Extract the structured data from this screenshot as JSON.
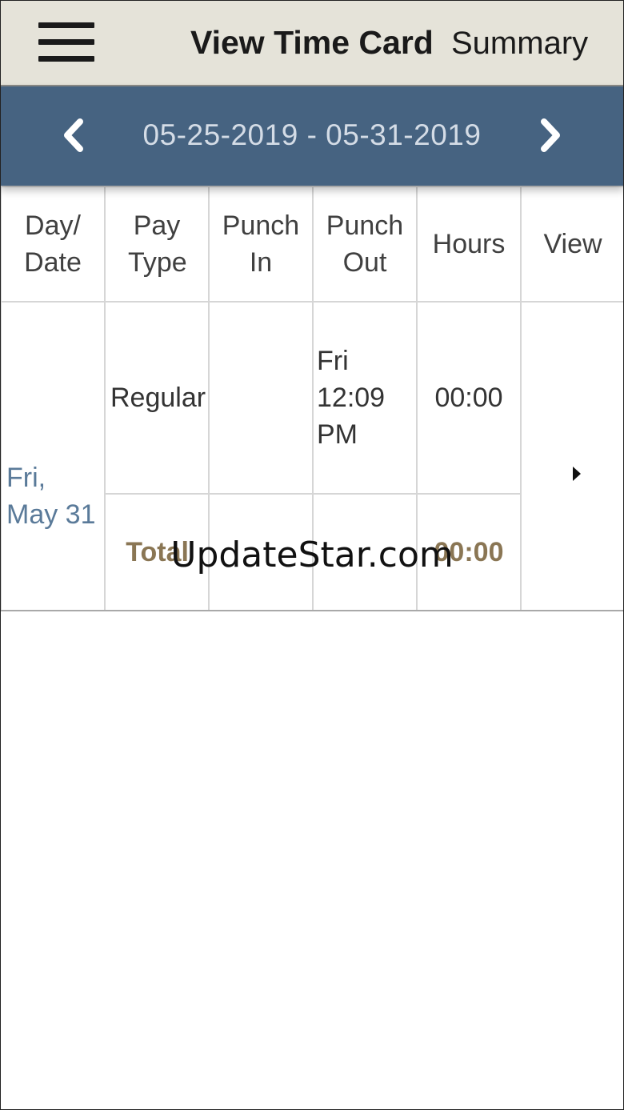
{
  "header": {
    "title": "View Time Card",
    "summary_label": "Summary"
  },
  "date_bar": {
    "range": "05-25-2019 - 05-31-2019"
  },
  "table": {
    "columns": [
      "Day/ Date",
      "Pay Type",
      "Punch In",
      "Punch Out",
      "Hours",
      "View"
    ],
    "rows": [
      {
        "day_date": "Fri, May 31",
        "pay_type": "Regular",
        "punch_in": "",
        "punch_out": "Fri 12:09 PM",
        "hours": "00:00"
      }
    ],
    "total": {
      "label": "Total",
      "hours": "00:00"
    }
  },
  "watermark": "UpdateStar.com",
  "icons": {
    "menu": "hamburger-menu-icon",
    "prev": "chevron-left-icon",
    "next": "chevron-right-icon",
    "view": "caret-right-icon"
  },
  "colors": {
    "topbar": "#e5e3d9",
    "datebar": "#466381",
    "date_text": "#d4dce6",
    "day_link": "#5a7a99",
    "total": "#8a7654"
  }
}
